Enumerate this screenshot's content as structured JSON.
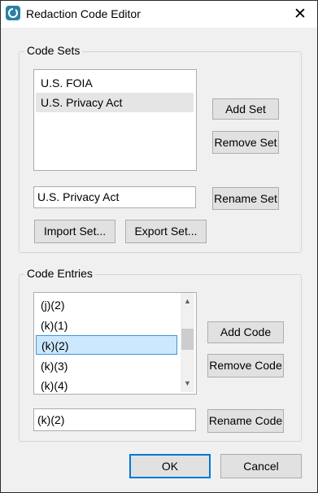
{
  "window": {
    "title": "Redaction Code Editor",
    "close_glyph": "✕"
  },
  "code_sets": {
    "legend": "Code Sets",
    "items": [
      {
        "label": "U.S. FOIA"
      },
      {
        "label": "U.S. Privacy Act"
      }
    ],
    "selected_index": 1,
    "add_label": "Add Set",
    "remove_label": "Remove Set",
    "name_value": "U.S. Privacy Act",
    "rename_label": "Rename Set",
    "import_label": "Import Set...",
    "export_label": "Export Set..."
  },
  "code_entries": {
    "legend": "Code Entries",
    "items": [
      {
        "label": "(j)(2)"
      },
      {
        "label": "(k)(1)"
      },
      {
        "label": "(k)(2)"
      },
      {
        "label": "(k)(3)"
      },
      {
        "label": "(k)(4)"
      }
    ],
    "selected_index": 2,
    "add_label": "Add Code",
    "remove_label": "Remove Code",
    "name_value": "(k)(2)",
    "rename_label": "Rename Code"
  },
  "footer": {
    "ok_label": "OK",
    "cancel_label": "Cancel"
  },
  "icons": {
    "app": "app-logo-icon",
    "scroll_up": "scroll-up-arrow-icon",
    "scroll_down": "scroll-down-arrow-icon"
  }
}
